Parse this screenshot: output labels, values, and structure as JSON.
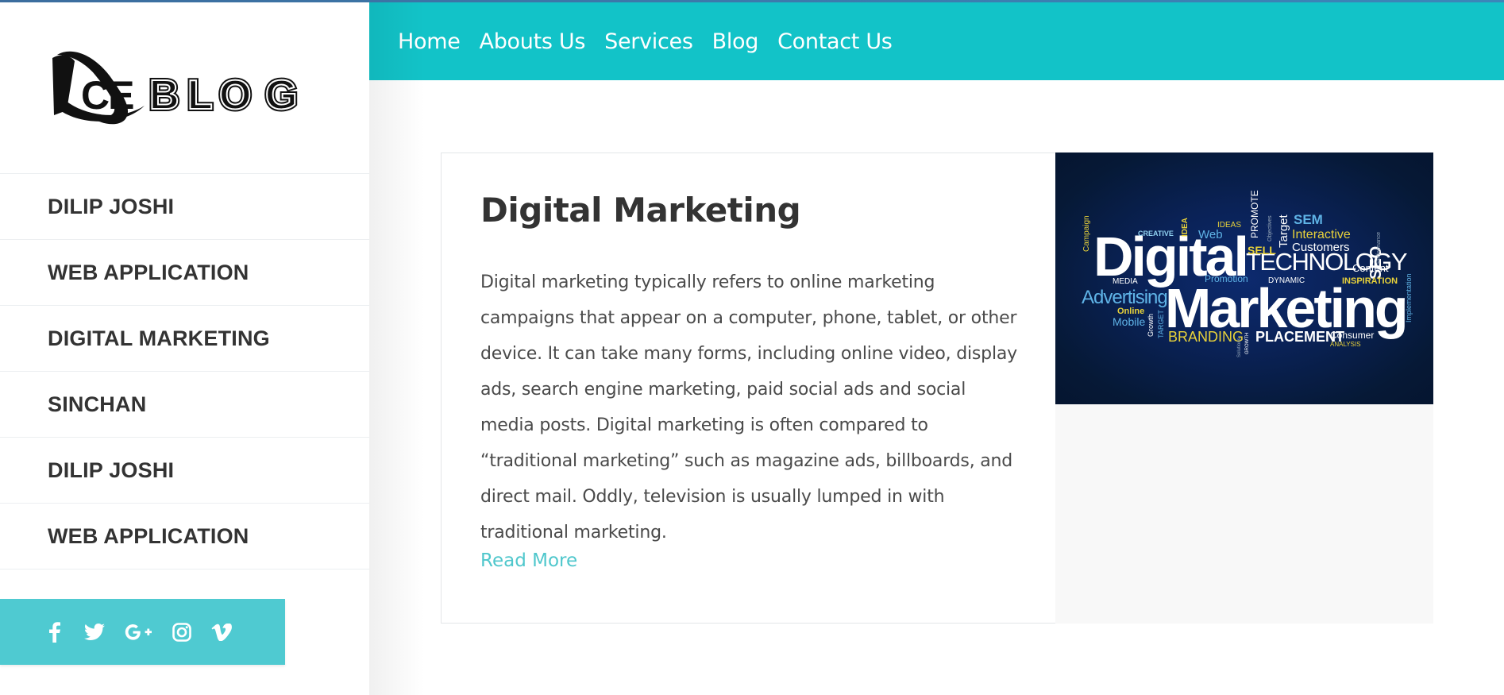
{
  "brand": {
    "logo_text": "ACEBLOG"
  },
  "sidebar": {
    "items": [
      {
        "label": "DILIP JOSHI"
      },
      {
        "label": "WEB APPLICATION"
      },
      {
        "label": "DIGITAL MARKETING"
      },
      {
        "label": "SINCHAN"
      },
      {
        "label": "DILIP JOSHI"
      },
      {
        "label": "WEB APPLICATION"
      }
    ],
    "social": [
      {
        "icon": "facebook-icon"
      },
      {
        "icon": "twitter-icon"
      },
      {
        "icon": "google-plus-icon"
      },
      {
        "icon": "instagram-icon"
      },
      {
        "icon": "vimeo-icon"
      }
    ]
  },
  "topnav": {
    "links": [
      {
        "label": "Home"
      },
      {
        "label": "Abouts Us"
      },
      {
        "label": "Services"
      },
      {
        "label": "Blog"
      },
      {
        "label": "Contact Us"
      }
    ]
  },
  "post": {
    "title": "Digital Marketing",
    "body": "Digital marketing typically refers to online marketing campaigns that appear on a computer, phone, tablet, or other device. It can take many forms, including online video, display ads, search engine marketing, paid social ads and social media posts. Digital marketing is often compared to “traditional marketing” such as magazine ads, billboards, and direct mail. Oddly, television is usually lumped in with traditional marketing.",
    "read_more": "Read More",
    "image_words": {
      "main1": "Digital",
      "main2": "Marketing",
      "technology": "TECHNOLOGY",
      "advertising": "Advertising",
      "branding": "BRANDING",
      "placement": "PLACEMENT",
      "interactive": "Interactive",
      "customers": "Customers",
      "sem": "SEM",
      "seo": "SEO",
      "sell": "SELL",
      "web": "Web",
      "ideas": "IDEAS",
      "idea": "IDEA",
      "promote": "PROMOTE",
      "target": "Target",
      "objectives": "Objectives",
      "creative": "CREATIVE",
      "campaign": "Campaign",
      "media": "MEDIA",
      "promotion": "Promotion",
      "dynamic": "DYNAMIC",
      "content": "Content",
      "inspiration": "INSPIRATION",
      "performance": "Performance",
      "implementation": "Implementation",
      "online": "Online",
      "mobile": "Mobile",
      "growth": "Growth",
      "target2": "TARGET",
      "solutions": "Solutions",
      "growth2": "GROWTH",
      "consumer": "Consumer",
      "analysis": "ANALYSIS"
    }
  },
  "colors": {
    "nav_bg": "#12c3c8",
    "social_bg": "#4fcad1",
    "accent": "#4fc7cc",
    "text": "#333333"
  }
}
